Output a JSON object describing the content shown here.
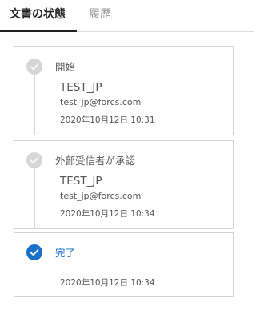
{
  "tabs": [
    {
      "label": "文書の状態",
      "active": true
    },
    {
      "label": "履歴",
      "active": false
    }
  ],
  "steps": [
    {
      "title": "開始",
      "status": "done",
      "user": "TEST_JP",
      "email": "test_jp@forcs.com",
      "time": "2020年10月12日 10:31",
      "icon": "check-icon"
    },
    {
      "title": "外部受信者が承認",
      "status": "done",
      "user": "TEST_JP",
      "email": "test_jp@forcs.com",
      "time": "2020年10月12日 10:34",
      "icon": "check-icon"
    },
    {
      "title": "完了",
      "status": "complete",
      "time": "2020年10月12日 10:34",
      "icon": "check-icon"
    }
  ],
  "colors": {
    "accent": "#1a6fc9",
    "pending": "#d6d6d6",
    "text": "#555555",
    "border": "#d4d4d4"
  }
}
